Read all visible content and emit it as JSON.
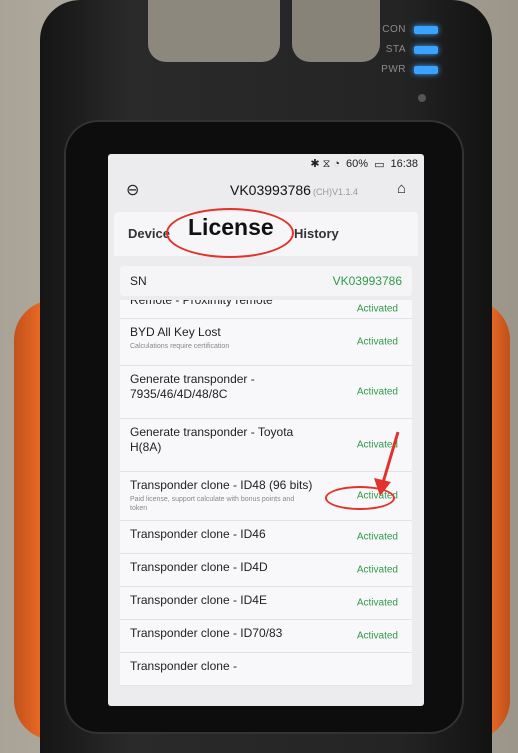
{
  "hardware": {
    "leds": [
      {
        "label": "CON"
      },
      {
        "label": "STA"
      },
      {
        "label": "PWR"
      }
    ],
    "led_color": "#3aa3ff"
  },
  "statusbar": {
    "icons": "✱ ⧖ ◔",
    "battery": "60%",
    "time": "16:38"
  },
  "header": {
    "back_icon": "⊖",
    "device_id": "VK03993786",
    "version": "(CH)V1.1.4",
    "home_icon": "⌂"
  },
  "tabs": [
    {
      "label": "Device"
    },
    {
      "label": "License"
    },
    {
      "label": "History"
    }
  ],
  "sn": {
    "label": "SN",
    "value": "VK03993786"
  },
  "licenses": [
    {
      "name": "Remote - Proximity remote",
      "description": "",
      "status": "Activated"
    },
    {
      "name": "BYD All Key Lost",
      "description": "Calculations require certification",
      "status": "Activated"
    },
    {
      "name": "Generate transponder - 7935/46/4D/48/8C",
      "description": "",
      "status": "Activated"
    },
    {
      "name": "Generate transponder - Toyota H(8A)",
      "description": "",
      "status": "Activated"
    },
    {
      "name": "Transponder clone - ID48 (96 bits)",
      "description": "Paid license, support calculate with bonus points and token",
      "status": "Activated"
    },
    {
      "name": "Transponder clone - ID46",
      "description": "",
      "status": "Activated"
    },
    {
      "name": "Transponder clone - ID4D",
      "description": "",
      "status": "Activated"
    },
    {
      "name": "Transponder clone - ID4E",
      "description": "",
      "status": "Activated"
    },
    {
      "name": "Transponder clone - ID70/83",
      "description": "",
      "status": "Activated"
    },
    {
      "name": "Transponder clone -",
      "description": "",
      "status": ""
    }
  ],
  "colors": {
    "activated": "#2f9a4a",
    "annotation": "#e2322c",
    "bumper": "#ea6a24"
  }
}
